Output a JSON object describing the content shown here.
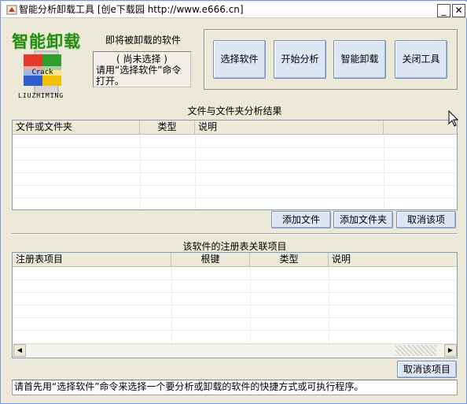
{
  "window": {
    "title": "智能分析卸载工具 [创e下载园 http://www.e666.cn]",
    "minimize_glyph": "_",
    "close_glyph": "✕"
  },
  "logo": {
    "title": "智能卸载",
    "badge_text": "Crack",
    "author": "LIUZHIMING"
  },
  "target": {
    "label": "即将被卸载的软件",
    "status": "( 尚未选择 )",
    "hint": "请用“选择软件”命令打开。"
  },
  "toolbar": {
    "select": "选择软件",
    "analyze": "开始分析",
    "uninstall": "智能卸载",
    "close": "关闭工具"
  },
  "files": {
    "caption": "文件与文件夹分析结果",
    "columns": [
      "文件或文件夹",
      "类型",
      "说明",
      ""
    ],
    "add_file": "添加文件",
    "add_folder": "添加文件夹",
    "remove": "取消该项"
  },
  "registry": {
    "caption": "该软件的注册表关联项目",
    "columns": [
      "注册表项目",
      "根键",
      "类型",
      "说明"
    ],
    "remove": "取消该项目"
  },
  "status_bar": "请首先用“选择软件”命令来选择一个要分析或卸载的软件的快捷方式或可执行程序。",
  "icons": {
    "app": "app-icon",
    "logo": "crack-logo-icon",
    "scroll_left": "arrow-left-icon",
    "scroll_right": "arrow-right-icon",
    "cursor": "mouse-cursor-icon"
  }
}
